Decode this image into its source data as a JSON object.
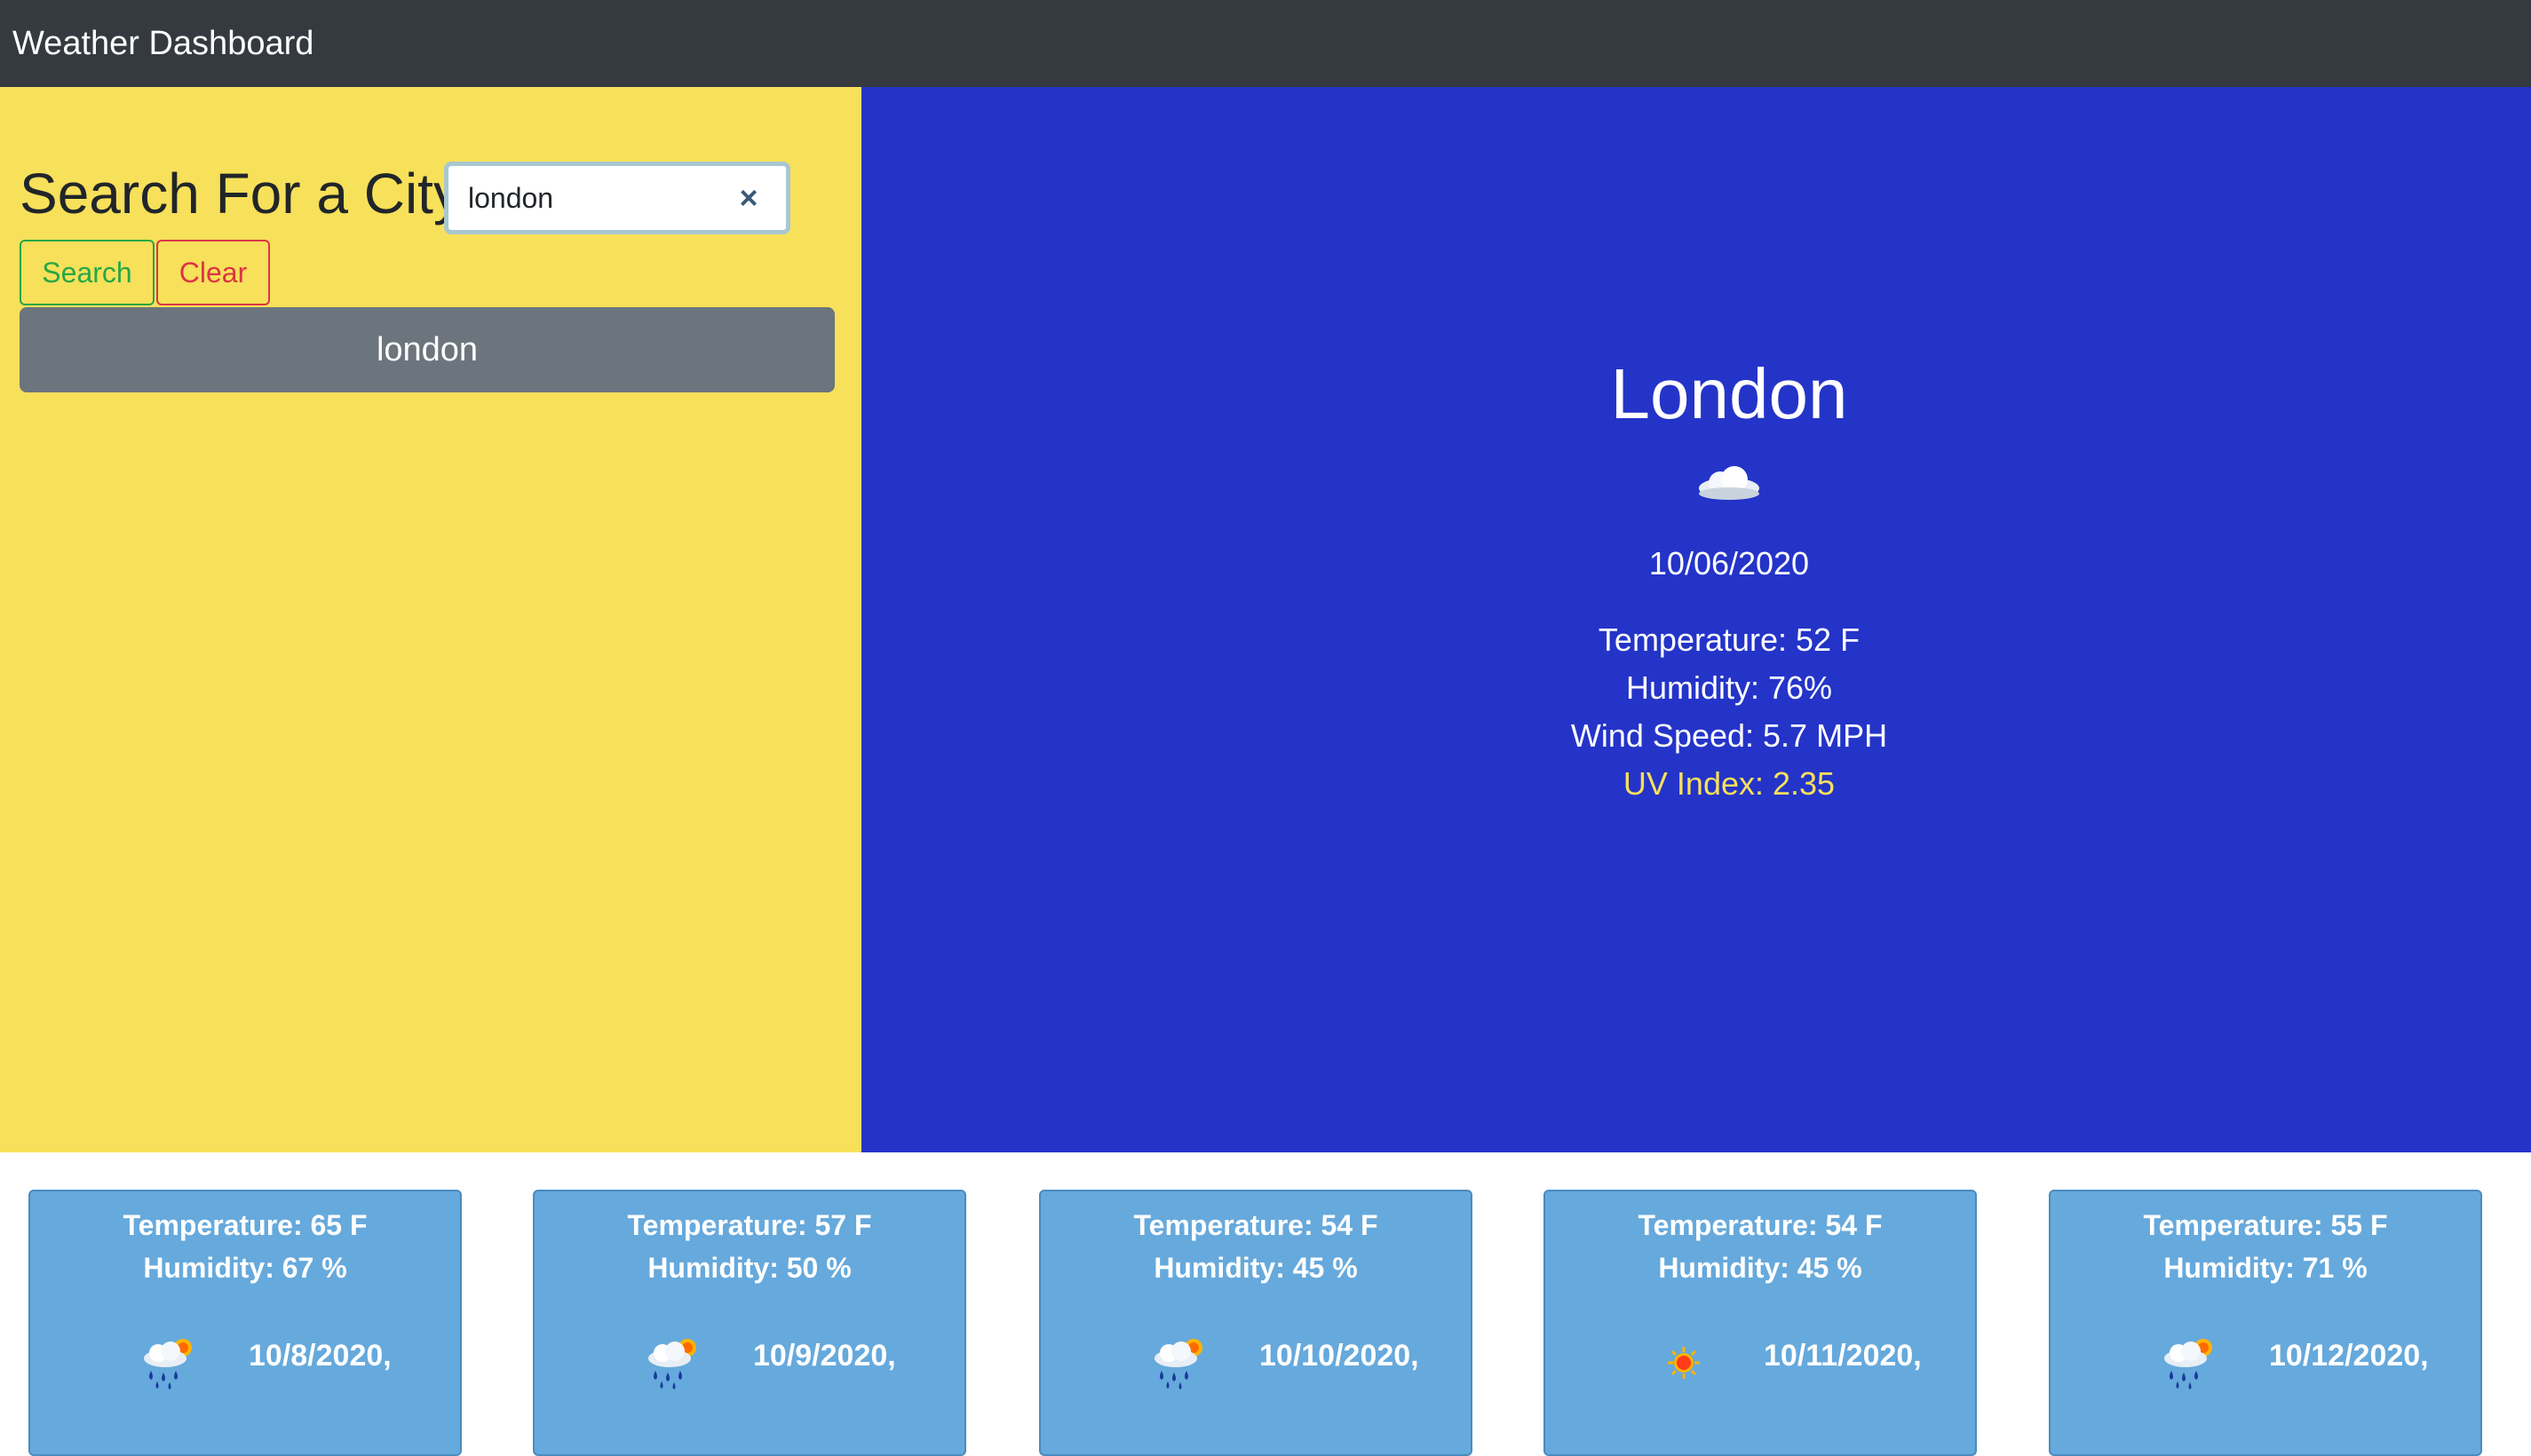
{
  "navbar": {
    "title": "Weather Dashboard"
  },
  "search": {
    "heading": "Search For a City",
    "input_value": "london",
    "clear_input_glyph": "×",
    "search_button": "Search",
    "clear_button": "Clear",
    "history": [
      "london"
    ]
  },
  "current": {
    "city": "London",
    "icon": "cloud-icon",
    "date": "10/06/2020",
    "temperature": "Temperature: 52 F",
    "humidity": "Humidity: 76%",
    "wind": "Wind Speed: 5.7 MPH",
    "uv": "UV Index: 2.35",
    "uv_color": "#f7e05a"
  },
  "forecast": [
    {
      "temperature": "Temperature: 65 F",
      "humidity": "Humidity: 67 %",
      "date": "10/8/2020,",
      "icon": "rain-sun-icon"
    },
    {
      "temperature": "Temperature: 57 F",
      "humidity": "Humidity: 50 %",
      "date": "10/9/2020,",
      "icon": "rain-sun-icon"
    },
    {
      "temperature": "Temperature: 54 F",
      "humidity": "Humidity: 45 %",
      "date": "10/10/2020,",
      "icon": "rain-sun-icon"
    },
    {
      "temperature": "Temperature: 54 F",
      "humidity": "Humidity: 45 %",
      "date": "10/11/2020,",
      "icon": "sun-icon"
    },
    {
      "temperature": "Temperature: 55 F",
      "humidity": "Humidity: 71 %",
      "date": "10/12/2020,",
      "icon": "rain-sun-icon"
    }
  ],
  "colors": {
    "navbar": "#343a40",
    "left_panel": "#f7e05a",
    "right_panel": "#2434c8",
    "history_button": "#6c757d",
    "forecast_card": "#66a9dc",
    "search_button": "#28a745",
    "clear_button": "#dc3545"
  }
}
